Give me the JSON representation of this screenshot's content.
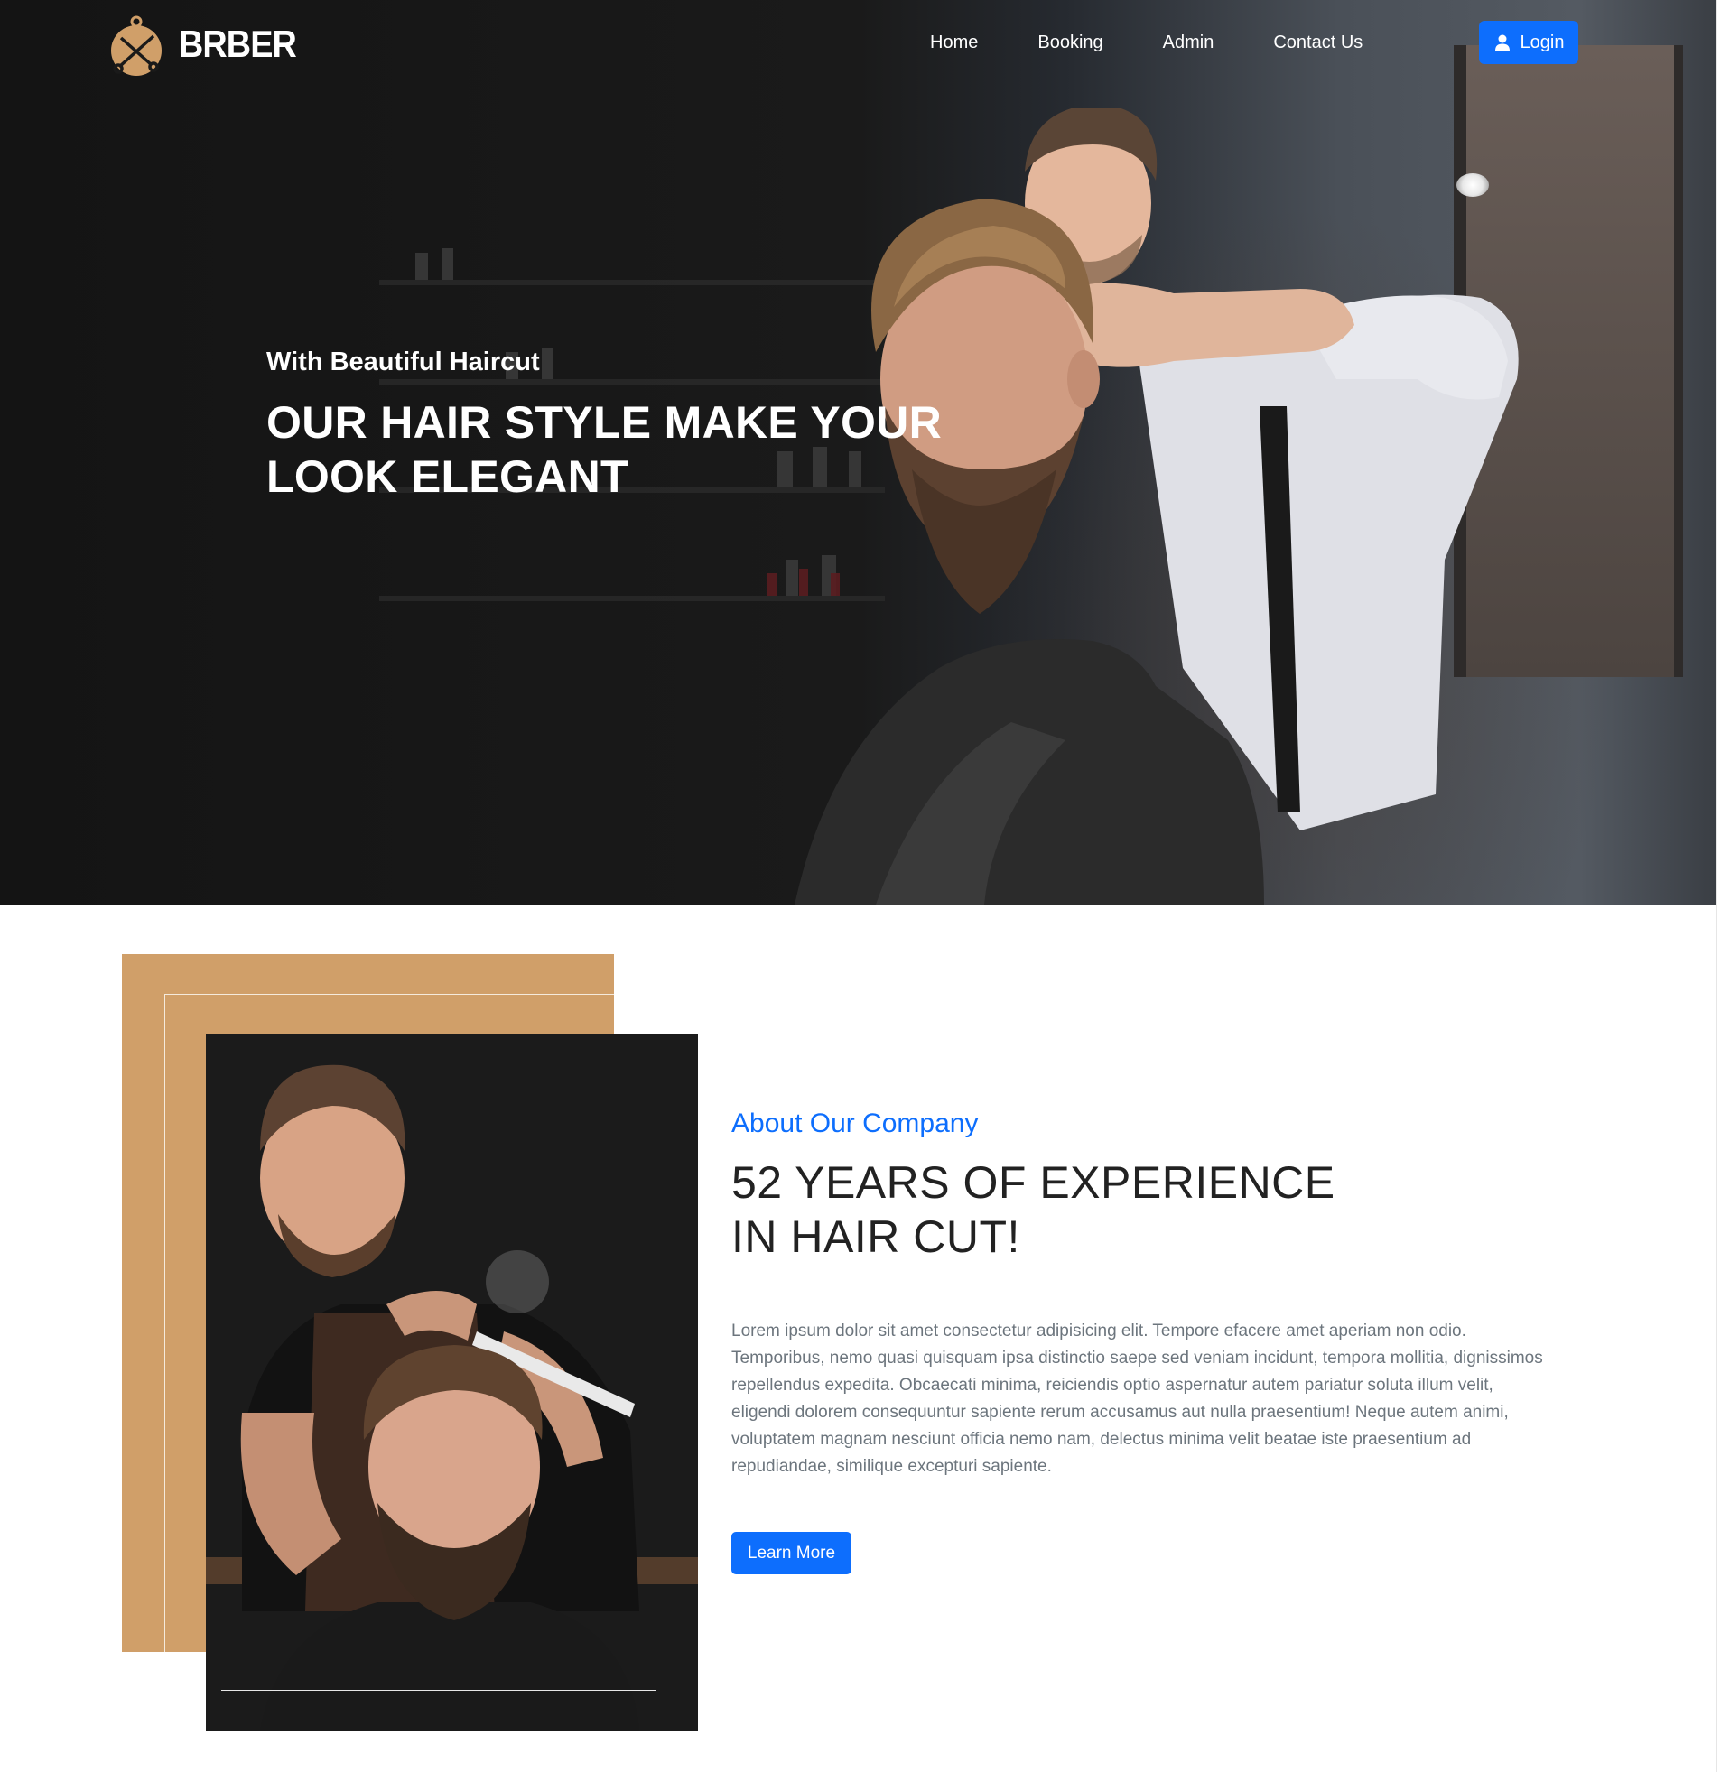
{
  "brand": {
    "name": "BRBER",
    "icon": "barber-scissors-logo-icon",
    "accent": "#d09f69"
  },
  "nav": {
    "links": [
      "Home",
      "Booking",
      "Admin",
      "Contact Us"
    ],
    "login_label": "Login",
    "login_icon": "user-icon",
    "button_color": "#0d6efd"
  },
  "hero": {
    "subtitle": "With Beautiful Haircut",
    "title": "OUR HAIR STYLE MAKE YOUR LOOK ELEGANT",
    "image": "barber-cutting-bearded-client-photo"
  },
  "about": {
    "kicker": "About Our Company",
    "title": "52 YEARS OF EXPERIENCE IN HAIR CUT!",
    "body": "Lorem ipsum dolor sit amet consectetur adipisicing elit. Tempore efacere amet aperiam non odio. Temporibus, nemo quasi quisquam ipsa distinctio saepe sed veniam incidunt, tempora mollitia, dignissimos repellendus expedita. Obcaecati minima, reiciendis optio aspernatur autem pariatur soluta illum velit, eligendi dolorem consequuntur sapiente rerum accusamus aut nulla praesentium! Neque autem animi, voluptatem magnam nesciunt officia nemo nam, delectus minima velit beatae iste praesentium ad repudiandae, similique excepturi sapiente.",
    "button_label": "Learn More",
    "image": "barber-trimming-beard-photo",
    "kicker_color": "#0d6efd"
  }
}
